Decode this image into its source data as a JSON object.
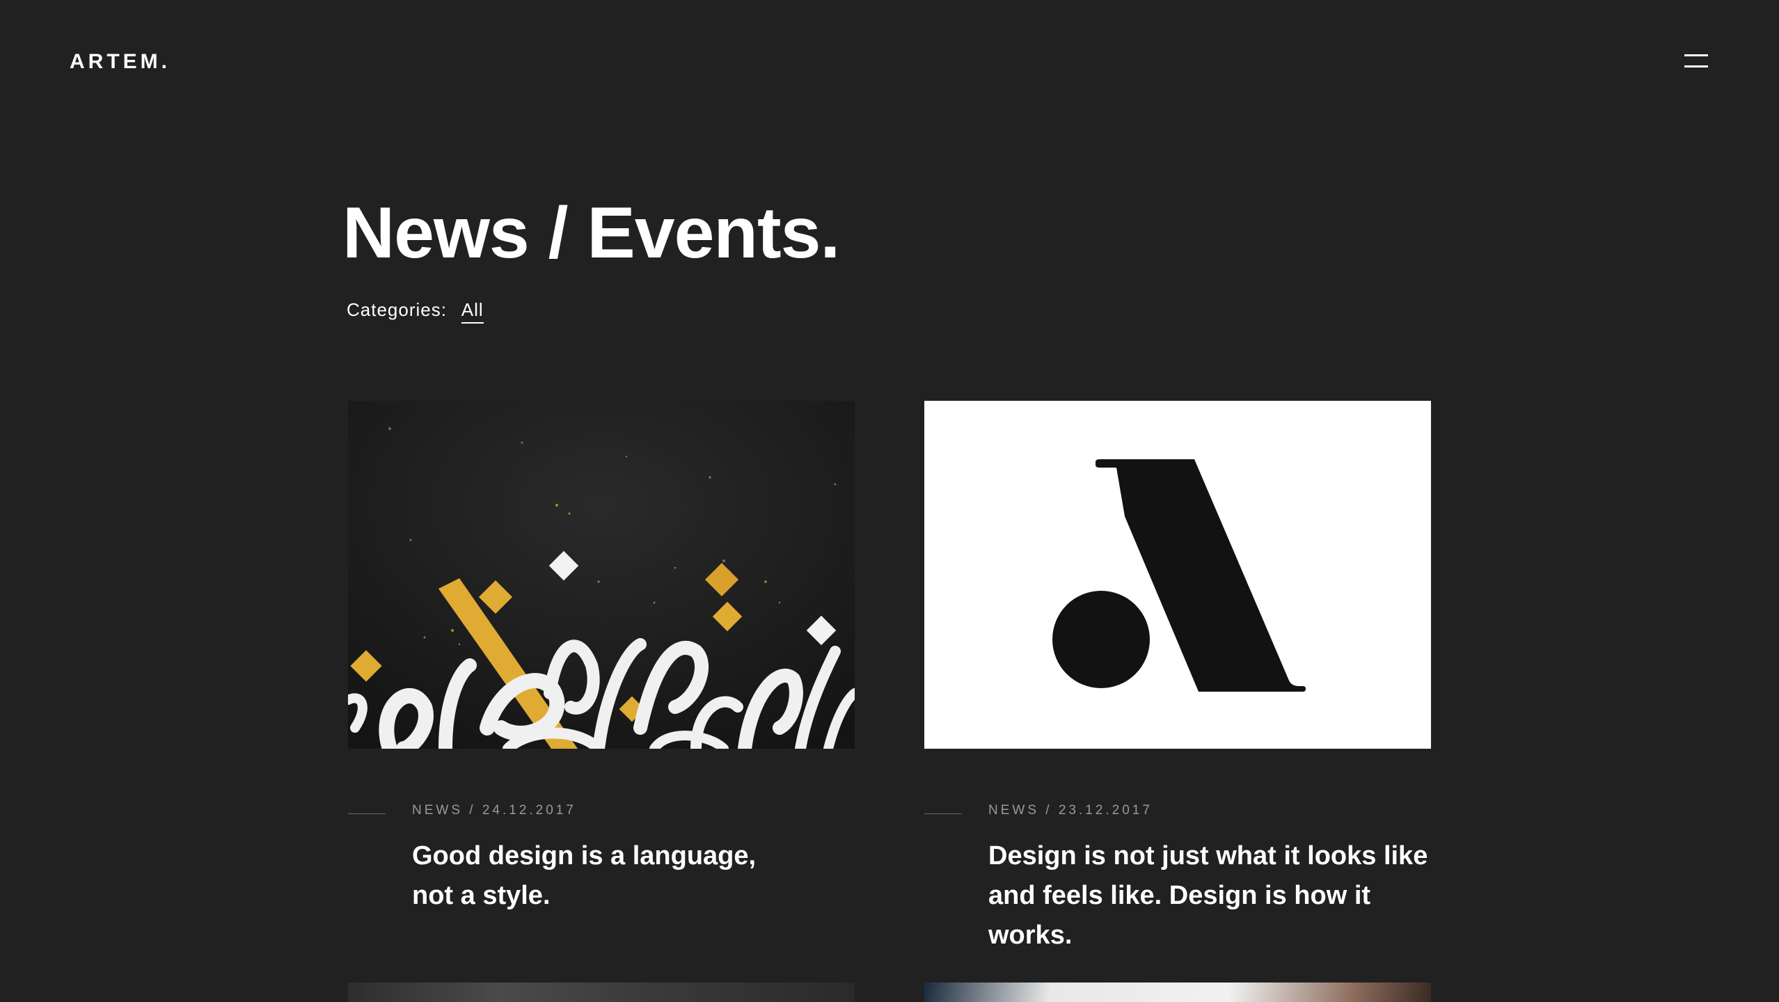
{
  "header": {
    "logo": "ARTEM.",
    "menu_icon": "hamburger-menu-icon"
  },
  "page": {
    "title": "News / Events.",
    "categories_label": "Categories:",
    "categories_active": "All"
  },
  "posts": [
    {
      "meta": "NEWS / 24.12.2017",
      "title": "Good design is a language, not a style.",
      "image": "arabic-calligraphy-artwork"
    },
    {
      "meta": "NEWS / 23.12.2017",
      "title": "Design is not just what it looks like and feels like. Design is how it works.",
      "image": "letter-a-logo-artwork"
    }
  ],
  "colors": {
    "background": "#212121",
    "text": "#ffffff",
    "meta": "#9a9a9a",
    "gold": "#e0ab33"
  }
}
